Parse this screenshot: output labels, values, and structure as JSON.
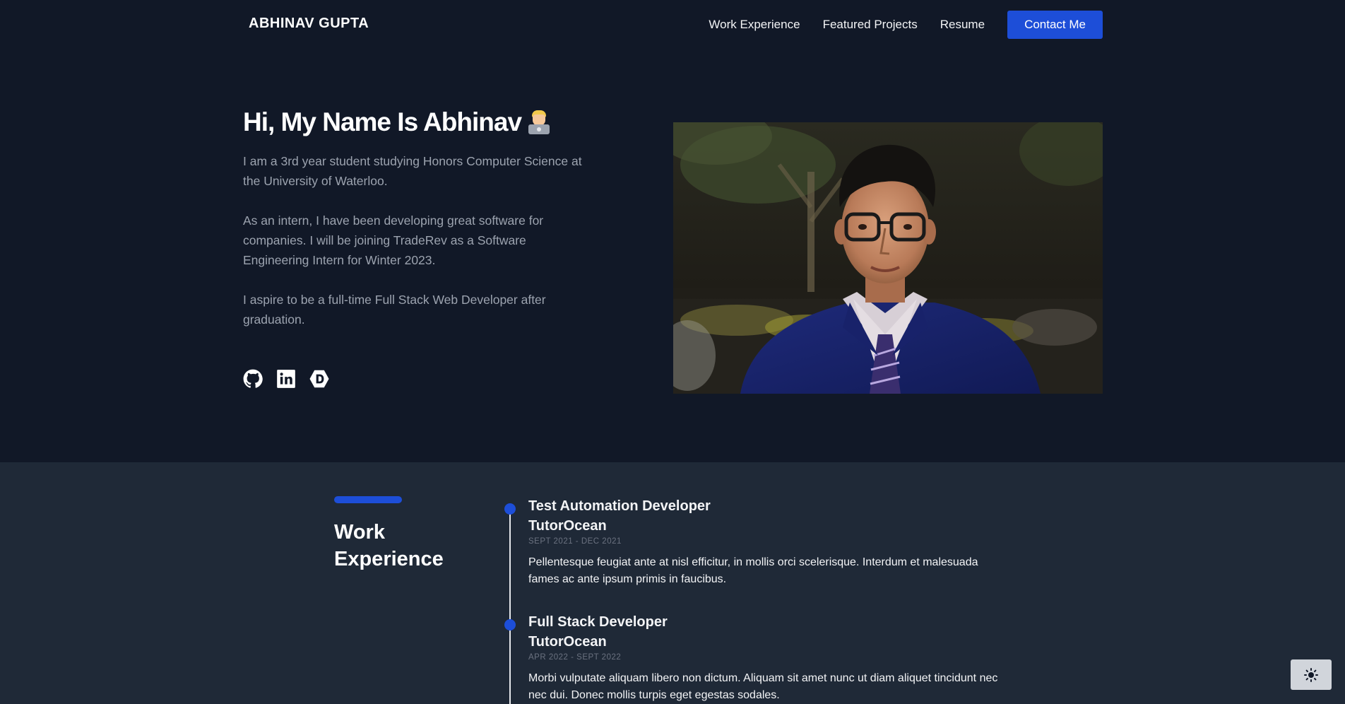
{
  "header": {
    "brand": "ABHINAV GUPTA",
    "nav": [
      "Work Experience",
      "Featured Projects",
      "Resume"
    ],
    "contact_label": "Contact Me"
  },
  "hero": {
    "title": "Hi, My Name Is Abhinav",
    "title_emoji_icon": "technologist-emoji-icon",
    "paragraphs": [
      "I am a 3rd year student studying Honors Computer Science at the University of Waterloo.",
      "As an intern, I have been developing great software for companies. I will be joining TradeRev as a Software Engineering Intern for Winter 2023.",
      "I aspire to be a full-time Full Stack Web Developer after graduation."
    ],
    "socials": [
      "github-icon",
      "linkedin-icon",
      "devpost-icon"
    ]
  },
  "work": {
    "title": "Work Experience",
    "jobs": [
      {
        "role": "Test Automation Developer",
        "company": "TutorOcean",
        "dates": "SEPT 2021 - DEC 2021",
        "description": "Pellentesque feugiat ante at nisl efficitur, in mollis orci scelerisque. Interdum et malesuada fames ac ante ipsum primis in faucibus."
      },
      {
        "role": "Full Stack Developer",
        "company": "TutorOcean",
        "dates": "APR 2022 - SEPT 2022",
        "description": "Morbi vulputate aliquam libero non dictum. Aliquam sit amet nunc ut diam aliquet tincidunt nec nec dui. Donec mollis turpis eget egestas sodales."
      }
    ]
  },
  "theme_toggle_icon": "sun-icon",
  "colors": {
    "background": "#111827",
    "section_background": "#1f2937",
    "accent": "#1d4ed8"
  }
}
